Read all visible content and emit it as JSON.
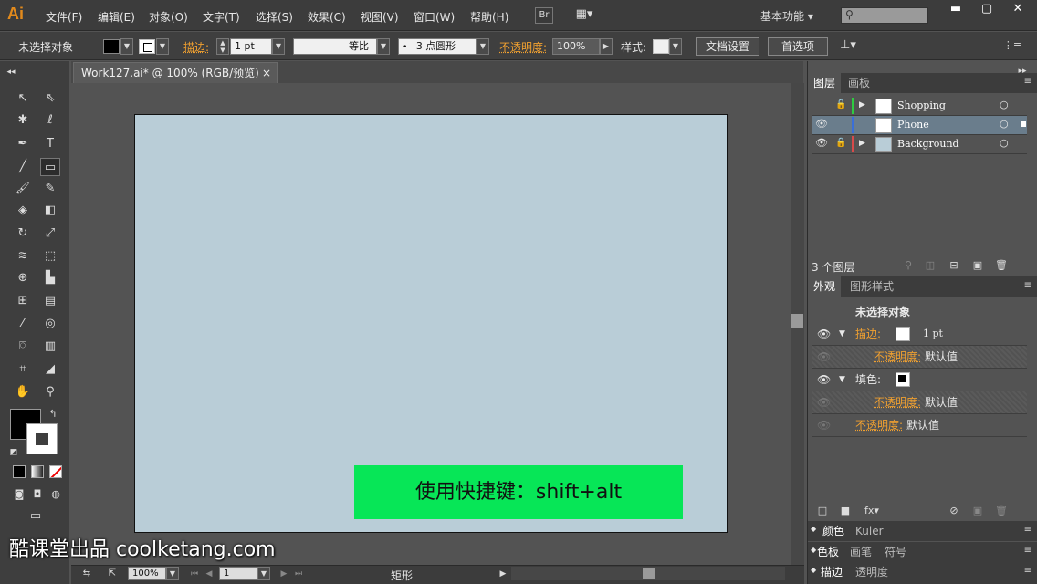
{
  "app": {
    "logo": "Ai",
    "bridge_label": "Br",
    "workspace": "基本功能"
  },
  "menu": [
    "文件(F)",
    "编辑(E)",
    "对象(O)",
    "文字(T)",
    "选择(S)",
    "效果(C)",
    "视图(V)",
    "窗口(W)",
    "帮助(H)"
  ],
  "control_bar": {
    "selection_status": "未选择对象",
    "stroke_label": "描边:",
    "stroke_weight": "1 pt",
    "profile_label": "等比",
    "brush_label": "3 点圆形",
    "opacity_label": "不透明度:",
    "opacity_value": "100%",
    "style_label": "样式:",
    "doc_setup_button": "文档设置",
    "preferences_button": "首选项"
  },
  "document": {
    "tab_title": "Work127.ai* @ 100% (RGB/预览)",
    "close_glyph": "×"
  },
  "status_bar": {
    "zoom": "100%",
    "artboard_number": "1",
    "current_tool": "矩形"
  },
  "layers_panel": {
    "tabs": [
      "图层",
      "画板"
    ],
    "layers": [
      {
        "name": "Shopping",
        "color": "#2ecc40",
        "visible": false,
        "locked": true,
        "expandable": true
      },
      {
        "name": "Phone",
        "color": "#3a6fd8",
        "visible": true,
        "locked": false,
        "expandable": false
      },
      {
        "name": "Background",
        "color": "#d84a4a",
        "visible": true,
        "locked": true,
        "expandable": true
      }
    ],
    "count_label": "3 个图层"
  },
  "appearance_panel": {
    "tabs": [
      "外观",
      "图形样式"
    ],
    "title": "未选择对象",
    "stroke_label": "描边:",
    "stroke_value": "1 pt",
    "opacity_label": "不透明度:",
    "default_value": "默认值",
    "fill_label": "填色:"
  },
  "collapsed_panels": {
    "row1": [
      "颜色",
      "Kuler"
    ],
    "row2": [
      "色板",
      "画笔",
      "符号"
    ],
    "row3": [
      "描边",
      "透明度"
    ]
  },
  "overlay": {
    "watermark": "酷课堂出品 coolketang.com",
    "banner": "使用快捷键：shift+alt"
  },
  "colors": {
    "artboard": "#b9cdd7",
    "banner": "#07e657",
    "accent": "#f0a030"
  }
}
